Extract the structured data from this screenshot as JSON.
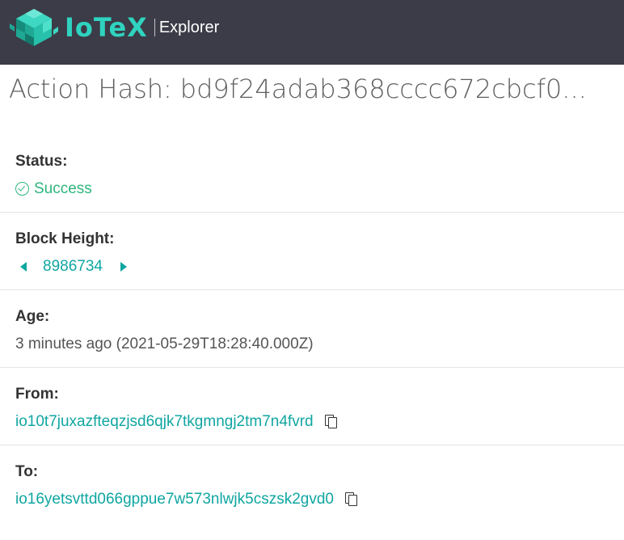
{
  "header": {
    "brand": "IoTeX",
    "subtitle": "Explorer",
    "brand_color": "#2fd3bf",
    "bar_color": "#3b3c47"
  },
  "page": {
    "title_prefix": "Action Hash:",
    "hash": "bd9f24adab368cccc672cbcf0..."
  },
  "details": {
    "status": {
      "label": "Status:",
      "value": "Success",
      "icon": "check-circle-icon",
      "color": "#2fb57d"
    },
    "block_height": {
      "label": "Block Height:",
      "value": "8986734",
      "prev_icon": "triangle-left-icon",
      "next_icon": "triangle-right-icon"
    },
    "age": {
      "label": "Age:",
      "value": "3 minutes ago (2021-05-29T18:28:40.000Z)"
    },
    "from": {
      "label": "From:",
      "value": "io10t7juxazfteqzjsd6qjk7tkgmngj2tm7n4fvrd",
      "icon": "copy-icon"
    },
    "to": {
      "label": "To:",
      "value": "io16yetsvttd066gppue7w573nlwjk5cszsk2gvd0",
      "icon": "copy-icon"
    }
  },
  "link_color": "#10a6a1"
}
